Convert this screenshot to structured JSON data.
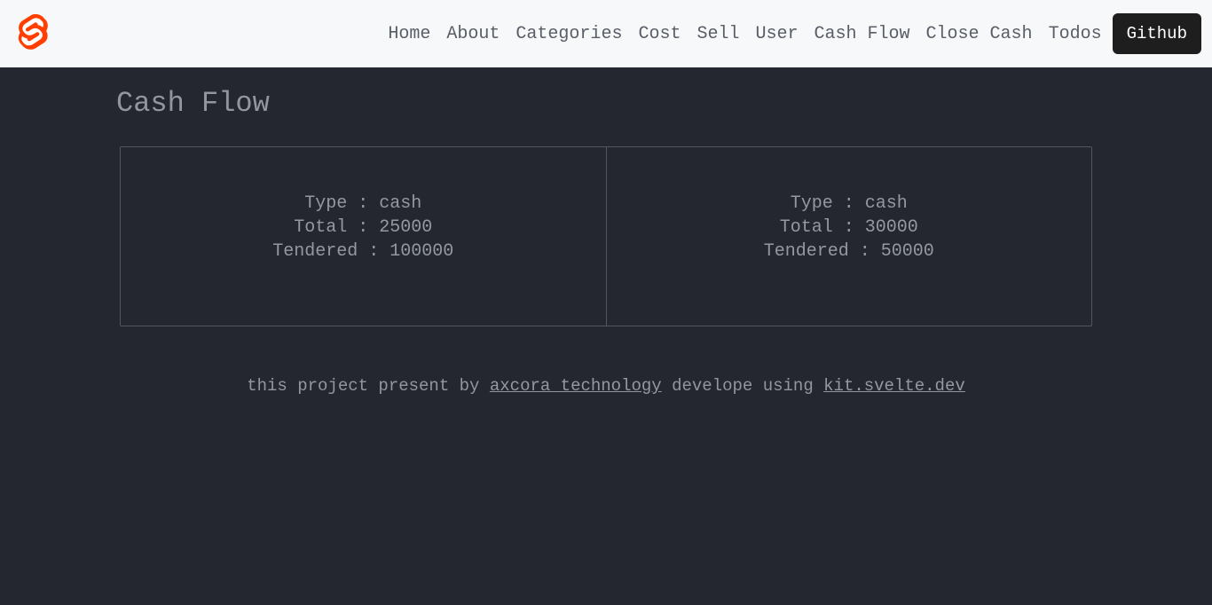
{
  "nav": {
    "items": [
      "Home",
      "About",
      "Categories",
      "Cost",
      "Sell",
      "User",
      "Cash Flow",
      "Close Cash",
      "Todos"
    ],
    "github_label": "Github"
  },
  "page": {
    "title": "Cash Flow"
  },
  "labels": {
    "type": "Type :",
    "total": "Total :",
    "tendered": "Tendered :"
  },
  "cards": [
    {
      "type": "cash",
      "total": "25000",
      "tendered": "100000"
    },
    {
      "type": "cash",
      "total": "30000",
      "tendered": "50000"
    }
  ],
  "footer": {
    "text_prefix": "this project present by ",
    "link1_text": "axcora technology",
    "text_mid": " develope using ",
    "link2_text": "kit.svelte.dev"
  }
}
